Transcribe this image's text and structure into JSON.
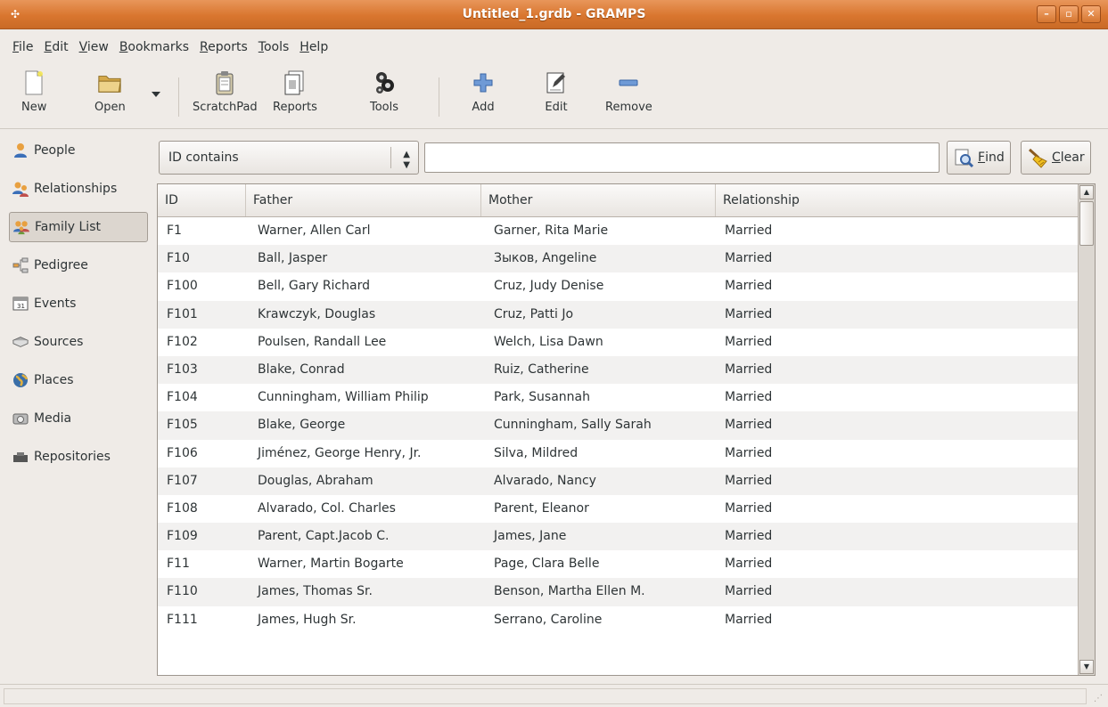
{
  "window": {
    "title": "Untitled_1.grdb - GRAMPS",
    "controls": [
      "minimize-icon",
      "maximize-icon",
      "close-icon"
    ]
  },
  "menu": [
    {
      "u": "F",
      "rest": "ile"
    },
    {
      "u": "E",
      "rest": "dit"
    },
    {
      "u": "V",
      "rest": "iew"
    },
    {
      "u": "B",
      "rest": "ookmarks"
    },
    {
      "u": "R",
      "rest": "eports"
    },
    {
      "u": "T",
      "rest": "ools"
    },
    {
      "u": "H",
      "rest": "elp"
    }
  ],
  "toolbar": {
    "new": "New",
    "open": "Open",
    "scratchpad": "ScratchPad",
    "reports": "Reports",
    "tools": "Tools",
    "add": "Add",
    "edit": "Edit",
    "remove": "Remove"
  },
  "sidebar": {
    "items": [
      {
        "label": "People",
        "icon": "person-icon"
      },
      {
        "label": "Relationships",
        "icon": "relationships-icon"
      },
      {
        "label": "Family List",
        "icon": "family-icon",
        "active": true
      },
      {
        "label": "Pedigree",
        "icon": "pedigree-icon"
      },
      {
        "label": "Events",
        "icon": "calendar-icon"
      },
      {
        "label": "Sources",
        "icon": "book-icon"
      },
      {
        "label": "Places",
        "icon": "globe-icon"
      },
      {
        "label": "Media",
        "icon": "media-icon"
      },
      {
        "label": "Repositories",
        "icon": "repository-icon"
      }
    ]
  },
  "search": {
    "filter": "ID contains",
    "value": "",
    "find_u": "F",
    "find_rest": "ind",
    "clear_u": "C",
    "clear_rest": "lear"
  },
  "table": {
    "columns": [
      "ID",
      "Father",
      "Mother",
      "Relationship"
    ],
    "rows": [
      [
        "F1",
        "Warner, Allen Carl",
        "Garner, Rita Marie",
        "Married"
      ],
      [
        "F10",
        "Ball, Jasper",
        "Зыков, Angeline",
        "Married"
      ],
      [
        "F100",
        "Bell, Gary Richard",
        "Cruz, Judy Denise",
        "Married"
      ],
      [
        "F101",
        "Krawczyk, Douglas",
        "Cruz, Patti Jo",
        "Married"
      ],
      [
        "F102",
        "Poulsen, Randall Lee",
        "Welch, Lisa Dawn",
        "Married"
      ],
      [
        "F103",
        "Blake, Conrad",
        "Ruiz, Catherine",
        "Married"
      ],
      [
        "F104",
        "Cunningham, William Philip",
        "Park, Susannah",
        "Married"
      ],
      [
        "F105",
        "Blake, George",
        "Cunningham, Sally Sarah",
        "Married"
      ],
      [
        "F106",
        "Jiménez, George Henry, Jr.",
        "Silva, Mildred",
        "Married"
      ],
      [
        "F107",
        "Douglas, Abraham",
        "Alvarado, Nancy",
        "Married"
      ],
      [
        "F108",
        "Alvarado, Col. Charles",
        "Parent, Eleanor",
        "Married"
      ],
      [
        "F109",
        "Parent, Capt.Jacob C.",
        "James, Jane",
        "Married"
      ],
      [
        "F11",
        "Warner, Martin Bogarte",
        "Page, Clara Belle",
        "Married"
      ],
      [
        "F110",
        "James, Thomas Sr.",
        "Benson, Martha Ellen M.",
        "Married"
      ],
      [
        "F111",
        "James, Hugh Sr.",
        "Serrano, Caroline",
        "Married"
      ]
    ]
  },
  "colors": {
    "titlebar": "#d9762f",
    "window_bg": "#efebe7",
    "row_alt": "#f2f1f0"
  }
}
